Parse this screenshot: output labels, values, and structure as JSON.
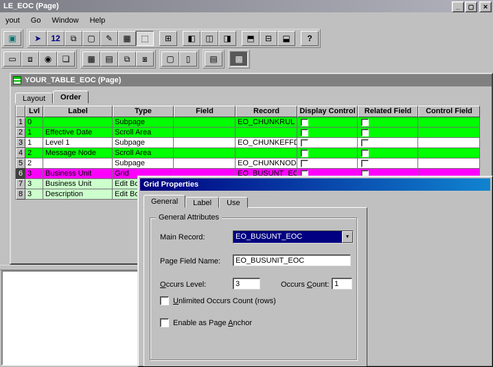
{
  "app": {
    "title": "LE_EOC (Page)",
    "window_controls": {
      "minimize": "_",
      "maximize": "▢",
      "close": "✕"
    },
    "menu": [
      "yout",
      "Go",
      "Window",
      "Help"
    ]
  },
  "toolbar_main": {
    "islands": [
      [
        [
          {
            "name": "toolbox-button",
            "glyph": "▣",
            "color": "#007070"
          }
        ]
      ],
      [
        [
          {
            "name": "select-pointer-button",
            "glyph": "➤",
            "color": "#000080"
          },
          {
            "name": "tab-order-button",
            "glyph": "12",
            "color": "#000080",
            "bold": true
          },
          {
            "name": "page-order-button",
            "glyph": "⧉"
          },
          {
            "name": "new-page-button",
            "glyph": "▢"
          },
          {
            "name": "edit-page-button",
            "glyph": "✎"
          },
          {
            "name": "show-grid-button",
            "glyph": "▦"
          },
          {
            "name": "snap-to-grid-button",
            "glyph": "⬚",
            "pressed": true
          }
        ],
        [
          {
            "name": "default-ordering-button",
            "glyph": "⊞"
          }
        ],
        [
          {
            "name": "align-left-button",
            "glyph": "◧"
          },
          {
            "name": "align-center-button",
            "glyph": "◫"
          },
          {
            "name": "align-right-button",
            "glyph": "◨"
          }
        ],
        [
          {
            "name": "align-top-button",
            "glyph": "⬒"
          },
          {
            "name": "align-middle-button",
            "glyph": "⊟"
          },
          {
            "name": "align-bottom-button",
            "glyph": "⬓"
          }
        ],
        [
          {
            "name": "help-button",
            "glyph": "?",
            "bold": true
          }
        ]
      ]
    ]
  },
  "toolbar_insert": {
    "islands": [
      [
        [
          {
            "name": "insert-frame-button",
            "glyph": "▭"
          },
          {
            "name": "insert-group-box-button",
            "glyph": "⧈"
          },
          {
            "name": "insert-radio-button",
            "glyph": "◉"
          },
          {
            "name": "insert-static-image-button",
            "glyph": "❏"
          }
        ]
      ],
      [
        [
          {
            "name": "insert-grid-button",
            "glyph": "▦"
          },
          {
            "name": "insert-scroll-area-button",
            "glyph": "▤"
          },
          {
            "name": "insert-subpage-button",
            "glyph": "⧉"
          },
          {
            "name": "insert-secondary-page-button",
            "glyph": "⧆"
          }
        ]
      ],
      [
        [
          {
            "name": "insert-push-button",
            "glyph": "▢"
          },
          {
            "name": "insert-edit-box-button",
            "glyph": "▯"
          }
        ]
      ],
      [
        [
          {
            "name": "insert-long-edit-button",
            "glyph": "▤"
          }
        ]
      ],
      [
        [
          {
            "name": "insert-image-control-button",
            "glyph": "▩",
            "pressed": true,
            "dark": true
          }
        ]
      ]
    ]
  },
  "inner": {
    "title": "YOUR_TABLE_EOC (Page)",
    "tabs": [
      {
        "label": "Layout",
        "active": false
      },
      {
        "label": "Order",
        "active": true
      }
    ]
  },
  "grid": {
    "columns": [
      "",
      "Lvl",
      "Label",
      "Type",
      "Field",
      "Record",
      "Display Control",
      "Related Field",
      "Control Field"
    ],
    "rows": [
      {
        "num": "1",
        "lvl": "0",
        "label": "",
        "type": "Subpage",
        "field": "",
        "record": "EO_CHUNKRUL",
        "bg": "#00FF00",
        "selected": false
      },
      {
        "num": "2",
        "lvl": "1",
        "label": "Effective Date",
        "type": "Scroll Area",
        "field": "",
        "record": "",
        "bg": "#00FF00",
        "selected": false
      },
      {
        "num": "3",
        "lvl": "1",
        "label": "Level 1",
        "type": "Subpage",
        "field": "",
        "record": "EO_CHUNKEFFD",
        "bg": "#FFFFFF",
        "selected": false
      },
      {
        "num": "4",
        "lvl": "2",
        "label": "Message Node",
        "type": "Scroll Area",
        "field": "",
        "record": "",
        "bg": "#00FF00",
        "selected": false
      },
      {
        "num": "5",
        "lvl": "2",
        "label": "",
        "type": "Subpage",
        "field": "",
        "record": "EO_CHUNKNOD",
        "bg": "#FFFFFF",
        "selected": false
      },
      {
        "num": "6",
        "lvl": "3",
        "label": "Business Unit",
        "type": "Grid",
        "field": "",
        "record": "EO_BUSUNT_EOC",
        "bg": "#FF00FF",
        "selected": true
      },
      {
        "num": "7",
        "lvl": "3",
        "label": "Business Unit",
        "type": "Edit Box",
        "field": "",
        "record": "",
        "bg": "#CCFFCC",
        "selected": false
      },
      {
        "num": "8",
        "lvl": "3",
        "label": "Description",
        "type": "Edit Box",
        "field": "",
        "record": "",
        "bg": "#CCFFCC",
        "selected": false
      }
    ]
  },
  "dialog": {
    "title": "Grid Properties",
    "tabs": [
      {
        "label": "General",
        "active": true
      },
      {
        "label": "Label",
        "active": false
      },
      {
        "label": "Use",
        "active": false
      }
    ],
    "group_title": "General Attributes",
    "dropdown_glyph": "▼",
    "main_record": {
      "label": "Main Record:",
      "value": "EO_BUSUNT_EOC"
    },
    "page_field_name": {
      "label": "Page Field Name:",
      "value": "EO_BUSUNIT_EOC"
    },
    "occurs_level": {
      "label_pre": "",
      "label_mn": "O",
      "label_post": "ccurs Level:",
      "value": "3"
    },
    "occurs_count": {
      "label_pre": "Occurs ",
      "label_mn": "C",
      "label_post": "ount:",
      "value": "1"
    },
    "unlimited_occurs": {
      "label_pre": "",
      "label_mn": "U",
      "label_post": "nlimited Occurs Count (rows)",
      "checked": false
    },
    "page_anchor": {
      "label_pre": "Enable as Page ",
      "label_mn": "A",
      "label_post": "nchor",
      "checked": false
    }
  },
  "colors": {
    "row_green": "#00FF00",
    "row_selected_magenta": "#FF00FF",
    "row_light_green": "#CCFFCC",
    "selection_blue": "#000080",
    "dialog_title_gradient": [
      "#000080",
      "#1084d0"
    ]
  }
}
